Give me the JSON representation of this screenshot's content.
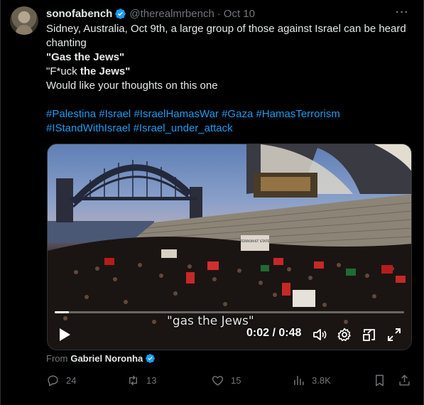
{
  "post": {
    "author_name": "sonofabench",
    "author_handle": "@therealmrbench",
    "separator": "·",
    "date": "Oct 10",
    "more_label": "···",
    "text_line1": "Sidney, Australia, Oct 9th, a large group of those against Israel can be heard chanting",
    "text_line2": "\"Gas the Jews\"",
    "text_line3_prefix": "\"F*uck ",
    "text_line3_bold": "the Jews\"",
    "text_line4": "Would like your thoughts on this one",
    "hashtags_line1": [
      "#Palestina",
      "#Israel",
      "#IsraelHamasWar",
      "#Gaza",
      "#HamasTerrorism"
    ],
    "hashtags_line2": [
      "#IStandWithIsrael",
      "#Israel_under_attack"
    ]
  },
  "video": {
    "caption": "\"gas the Jews\"",
    "time": "0:02 / 0:48",
    "progress": 0.04,
    "sign_text": "TERRORIST STATE"
  },
  "source": {
    "label": "From",
    "name": "Gabriel Noronha"
  },
  "actions": {
    "replies": "24",
    "reposts": "13",
    "likes": "15",
    "views": "3.8K"
  },
  "colors": {
    "background": "#000000",
    "text": "#e7e9ea",
    "muted": "#71767b",
    "link": "#1d9bf0",
    "verified": "#1d9bf0"
  }
}
